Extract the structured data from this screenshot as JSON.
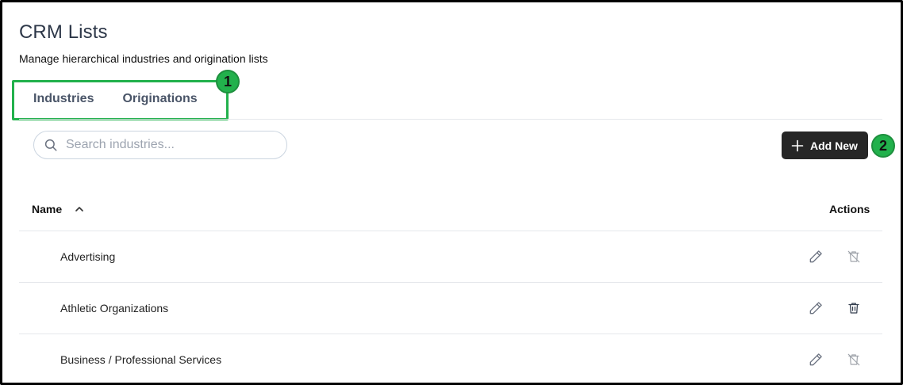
{
  "header": {
    "title": "CRM Lists",
    "subtitle": "Manage hierarchical industries and origination lists"
  },
  "tabs": [
    {
      "label": "Industries"
    },
    {
      "label": "Originations"
    }
  ],
  "annotations": {
    "badge1": "1",
    "badge2": "2",
    "accent_color": "#22b14c"
  },
  "search": {
    "placeholder": "Search industries...",
    "value": ""
  },
  "toolbar": {
    "add_label": "Add New"
  },
  "table": {
    "columns": {
      "name": "Name",
      "actions": "Actions"
    },
    "sort": "ascending",
    "rows": [
      {
        "name": "Advertising",
        "delete_enabled": false
      },
      {
        "name": "Athletic Organizations",
        "delete_enabled": true
      },
      {
        "name": "Business / Professional Services",
        "delete_enabled": false
      }
    ]
  }
}
